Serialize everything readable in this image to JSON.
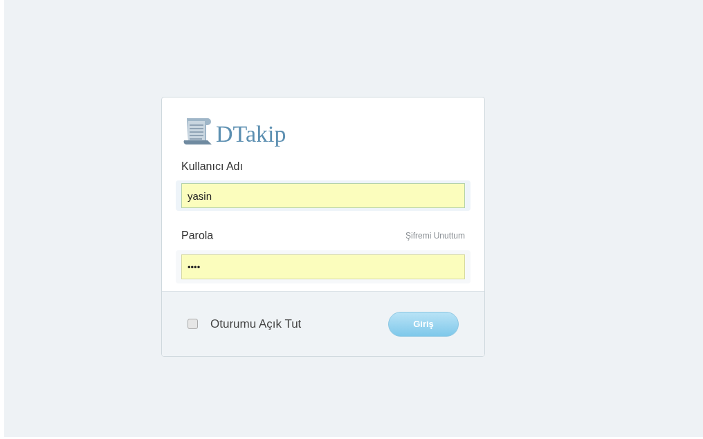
{
  "logo": {
    "text": "DTakip"
  },
  "username": {
    "label": "Kullanıcı Adı",
    "value": "yasin"
  },
  "password": {
    "label": "Parola",
    "value": "••••",
    "forgot_link": "Şifremi Unuttum"
  },
  "remember": {
    "label": "Oturumu Açık Tut",
    "checked": false
  },
  "submit": {
    "label": "Giriş"
  }
}
